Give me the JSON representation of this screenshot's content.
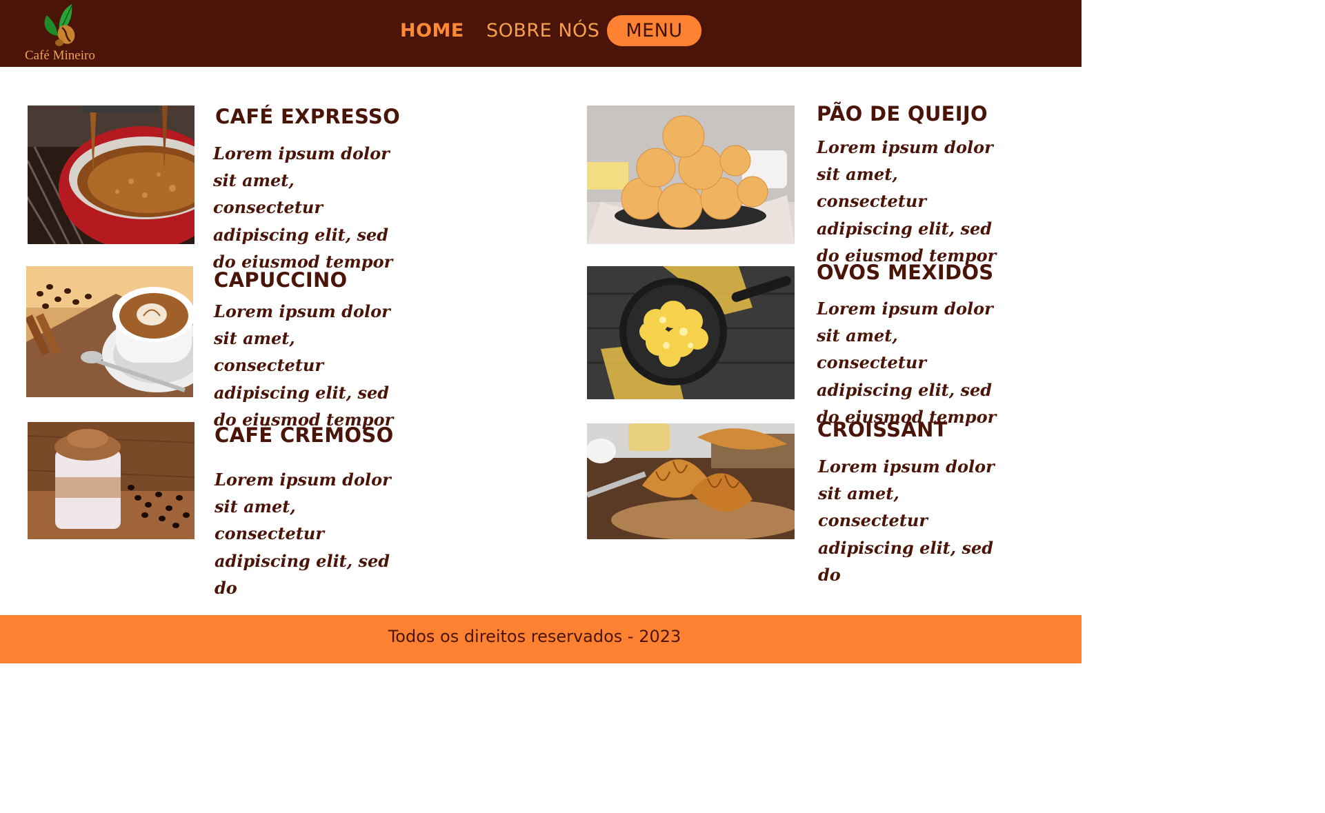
{
  "header": {
    "logo_text": "Café Mineiro",
    "nav": {
      "home": "HOME",
      "about": "SOBRE NÓS",
      "menu": "MENU"
    }
  },
  "menu_items": [
    {
      "title": "CAFÉ EXPRESSO",
      "description": "Lorem ipsum dolor sit amet, consectetur adipiscing elit, sed do eiusmod tempor"
    },
    {
      "title": "CAPUCCINO",
      "description": "Lorem ipsum dolor sit amet, consectetur adipiscing elit, sed do eiusmod tempor"
    },
    {
      "title": "CAFÉ CREMOSO",
      "description": "Lorem ipsum dolor sit amet, consectetur adipiscing elit, sed do"
    },
    {
      "title": "PÃO DE QUEIJO",
      "description": "Lorem ipsum dolor sit amet, consectetur adipiscing elit, sed do eiusmod tempor"
    },
    {
      "title": "OVOS MEXIDOS",
      "description": "Lorem ipsum dolor sit amet, consectetur adipiscing elit, sed do eiusmod tempor"
    },
    {
      "title": "CROISSANT",
      "description": "Lorem ipsum dolor sit amet, consectetur adipiscing elit, sed do"
    }
  ],
  "footer": {
    "text": "Todos os direitos reservados - 2023"
  },
  "colors": {
    "header_bg": "#4a1508",
    "accent": "#ff8233",
    "text_dark": "#4a1508"
  }
}
